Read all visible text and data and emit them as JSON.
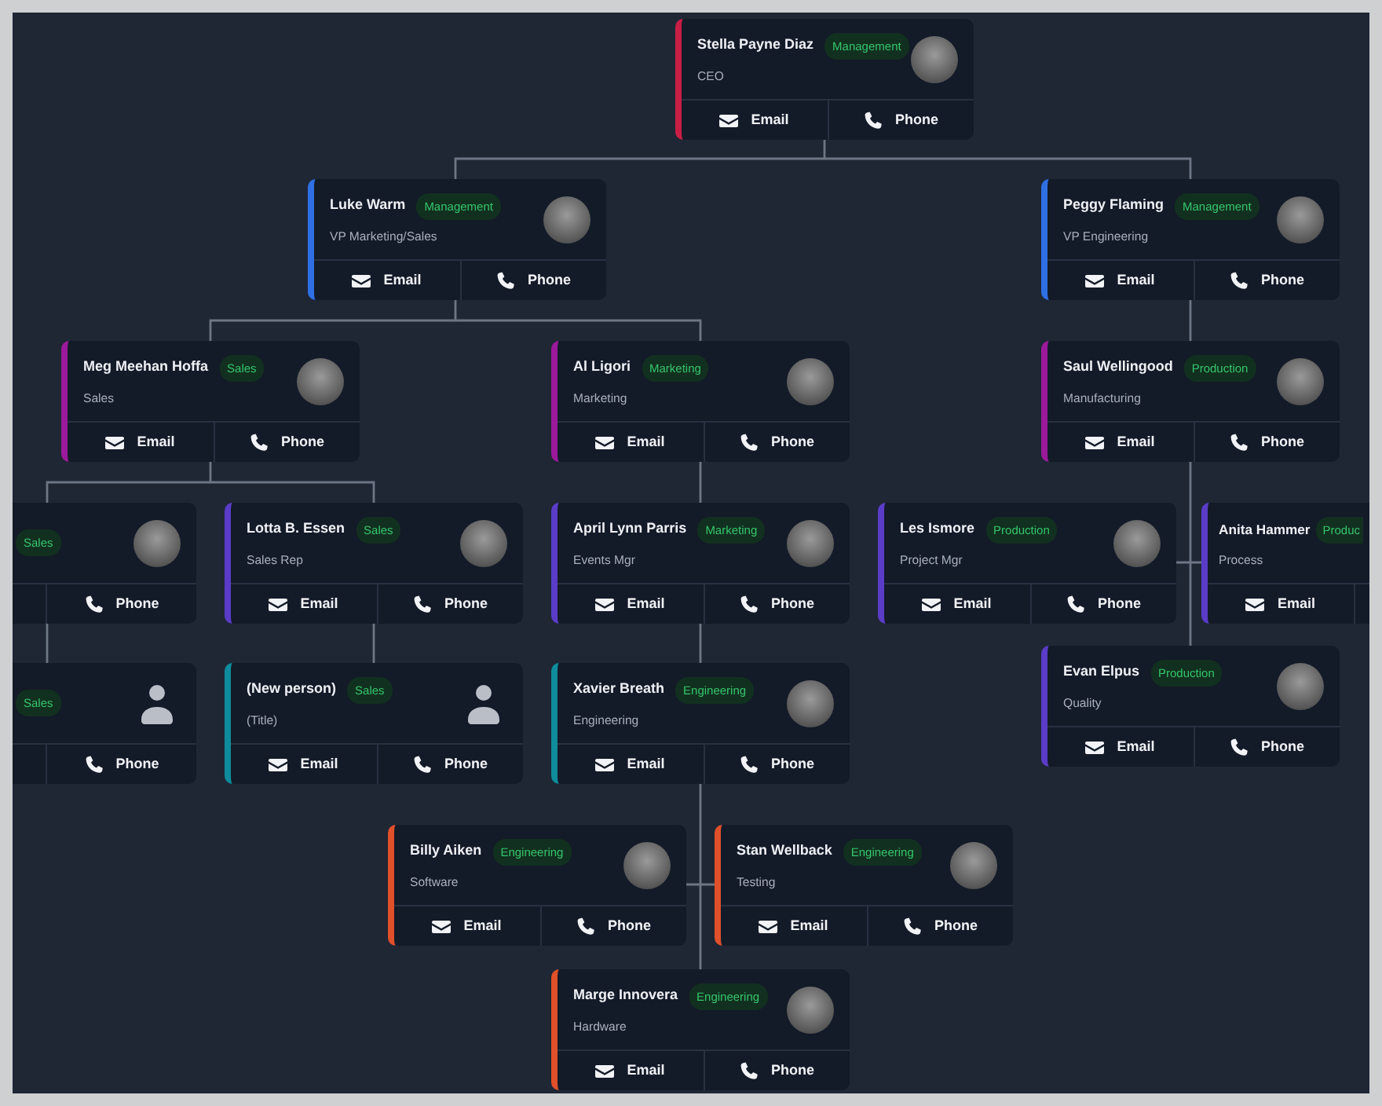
{
  "org_chart": {
    "nodes": [
      {
        "name": "Stella Payne Diaz",
        "department": "Management",
        "title": "CEO",
        "color": "#c81e45",
        "avatar": {
          "kind": "photo"
        },
        "buttons": [
          {
            "kind": "email",
            "label": "Email"
          },
          {
            "kind": "phone",
            "label": "Phone"
          }
        ]
      },
      {
        "name": "Luke Warm",
        "department": "Management",
        "title": "VP Marketing/Sales",
        "color": "#2f6fe4",
        "avatar": {
          "kind": "photo"
        },
        "buttons": [
          {
            "kind": "email",
            "label": "Email"
          },
          {
            "kind": "phone",
            "label": "Phone"
          }
        ]
      },
      {
        "name": "Peggy Flaming",
        "department": "Management",
        "title": "VP Engineering",
        "color": "#2f6fe4",
        "avatar": {
          "kind": "photo"
        },
        "buttons": [
          {
            "kind": "email",
            "label": "Email"
          },
          {
            "kind": "phone",
            "label": "Phone"
          }
        ]
      },
      {
        "name": "Meg Meehan Hoffa",
        "department": "Sales",
        "title": "Sales",
        "color": "#9b1a9b",
        "avatar": {
          "kind": "photo"
        },
        "buttons": [
          {
            "kind": "email",
            "label": "Email"
          },
          {
            "kind": "phone",
            "label": "Phone"
          }
        ]
      },
      {
        "name": "Al Ligori",
        "department": "Marketing",
        "title": "Marketing",
        "color": "#9b1a9b",
        "avatar": {
          "kind": "photo"
        },
        "buttons": [
          {
            "kind": "email",
            "label": "Email"
          },
          {
            "kind": "phone",
            "label": "Phone"
          }
        ]
      },
      {
        "name": "Saul Wellingood",
        "department": "Production",
        "title": "Manufacturing",
        "color": "#9b1a9b",
        "avatar": {
          "kind": "photo"
        },
        "buttons": [
          {
            "kind": "email",
            "label": "Email"
          },
          {
            "kind": "phone",
            "label": "Phone"
          }
        ]
      },
      {
        "department": "Sales",
        "avatar": {
          "kind": "photo"
        },
        "buttons": [
          {
            "kind": "phone",
            "label": "Phone"
          }
        ]
      },
      {
        "name": "Lotta B. Essen",
        "department": "Sales",
        "title": "Sales Rep",
        "color": "#5a3cc8",
        "avatar": {
          "kind": "photo"
        },
        "buttons": [
          {
            "kind": "email",
            "label": "Email"
          },
          {
            "kind": "phone",
            "label": "Phone"
          }
        ]
      },
      {
        "name": "April Lynn Parris",
        "department": "Marketing",
        "title": "Events Mgr",
        "color": "#5a3cc8",
        "avatar": {
          "kind": "photo"
        },
        "buttons": [
          {
            "kind": "email",
            "label": "Email"
          },
          {
            "kind": "phone",
            "label": "Phone"
          }
        ]
      },
      {
        "name": "Les Ismore",
        "department": "Production",
        "title": "Project Mgr",
        "color": "#5a3cc8",
        "avatar": {
          "kind": "photo"
        },
        "buttons": [
          {
            "kind": "email",
            "label": "Email"
          },
          {
            "kind": "phone",
            "label": "Phone"
          }
        ]
      },
      {
        "name": "Anita Hammer",
        "department": "Produc",
        "title": "Process",
        "color": "#5a3cc8",
        "buttons": [
          {
            "kind": "email",
            "label": "Email"
          }
        ]
      },
      {
        "department": "Sales",
        "avatar": {
          "kind": "silhouette"
        },
        "buttons": [
          {
            "kind": "phone",
            "label": "Phone"
          }
        ]
      },
      {
        "name": "(New person)",
        "department": "Sales",
        "title": "(Title)",
        "color": "#0e8c9c",
        "avatar": {
          "kind": "silhouette"
        },
        "buttons": [
          {
            "kind": "email",
            "label": "Email"
          },
          {
            "kind": "phone",
            "label": "Phone"
          }
        ]
      },
      {
        "name": "Xavier Breath",
        "department": "Engineering",
        "title": "Engineering",
        "color": "#0e8c9c",
        "avatar": {
          "kind": "photo"
        },
        "buttons": [
          {
            "kind": "email",
            "label": "Email"
          },
          {
            "kind": "phone",
            "label": "Phone"
          }
        ]
      },
      {
        "name": "Evan Elpus",
        "department": "Production",
        "title": "Quality",
        "color": "#5a3cc8",
        "avatar": {
          "kind": "photo"
        },
        "buttons": [
          {
            "kind": "email",
            "label": "Email"
          },
          {
            "kind": "phone",
            "label": "Phone"
          }
        ]
      },
      {
        "name": "Billy Aiken",
        "department": "Engineering",
        "title": "Software",
        "color": "#e0502a",
        "avatar": {
          "kind": "photo"
        },
        "buttons": [
          {
            "kind": "email",
            "label": "Email"
          },
          {
            "kind": "phone",
            "label": "Phone"
          }
        ]
      },
      {
        "name": "Stan Wellback",
        "department": "Engineering",
        "title": "Testing",
        "color": "#e0502a",
        "avatar": {
          "kind": "photo"
        },
        "buttons": [
          {
            "kind": "email",
            "label": "Email"
          },
          {
            "kind": "phone",
            "label": "Phone"
          }
        ]
      },
      {
        "name": "Marge Innovera",
        "department": "Engineering",
        "title": "Hardware",
        "color": "#e0502a",
        "avatar": {
          "kind": "photo"
        },
        "buttons": [
          {
            "kind": "email",
            "label": "Email"
          },
          {
            "kind": "phone",
            "label": "Phone"
          }
        ]
      }
    ]
  }
}
